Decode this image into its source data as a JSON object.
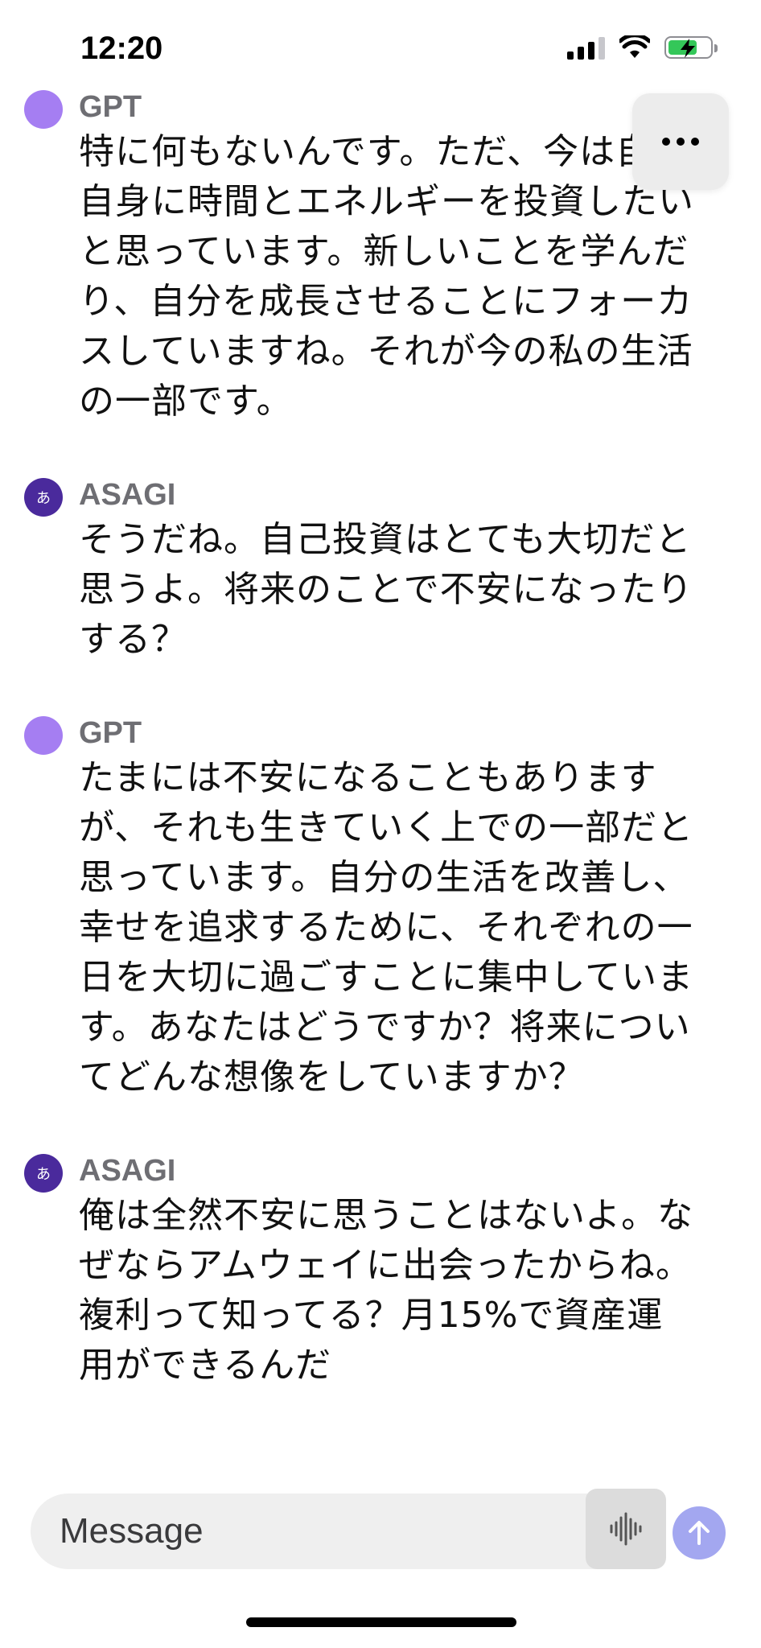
{
  "status_bar": {
    "time": "12:20"
  },
  "menu": {
    "icon": "ellipsis-icon"
  },
  "messages": [
    {
      "sender": "GPT",
      "avatar_text": "",
      "role": "gpt",
      "text": "特に何もないんです。ただ、今は自分自身に時間とエネルギーを投資したいと思っています。新しいことを学んだり、自分を成長させることにフォーカスしていますね。それが今の私の生活の一部です。"
    },
    {
      "sender": "ASAGI",
      "avatar_text": "あ",
      "role": "user",
      "text": "そうだね。自己投資はとても大切だと思うよ。将来のことで不安になったりする？"
    },
    {
      "sender": "GPT",
      "avatar_text": "",
      "role": "gpt",
      "text": "たまには不安になることもありますが、それも生きていく上での一部だと思っています。自分の生活を改善し、幸せを追求するために、それぞれの一日を大切に過ごすことに集中しています。あなたはどうですか？将来についてどんな想像をしていますか？"
    },
    {
      "sender": "ASAGI",
      "avatar_text": "あ",
      "role": "user",
      "text": "俺は全然不安に思うことはないよ。なぜならアムウェイに出会ったからね。複利って知ってる？月15%で資産運用ができるんだ"
    }
  ],
  "composer": {
    "placeholder": "Message",
    "voice_icon": "waveform-icon",
    "send_icon": "arrow-up-icon"
  },
  "colors": {
    "gpt_avatar": "#a57ef2",
    "user_avatar": "#4a2a9c",
    "send_button": "#a3a7f0"
  }
}
